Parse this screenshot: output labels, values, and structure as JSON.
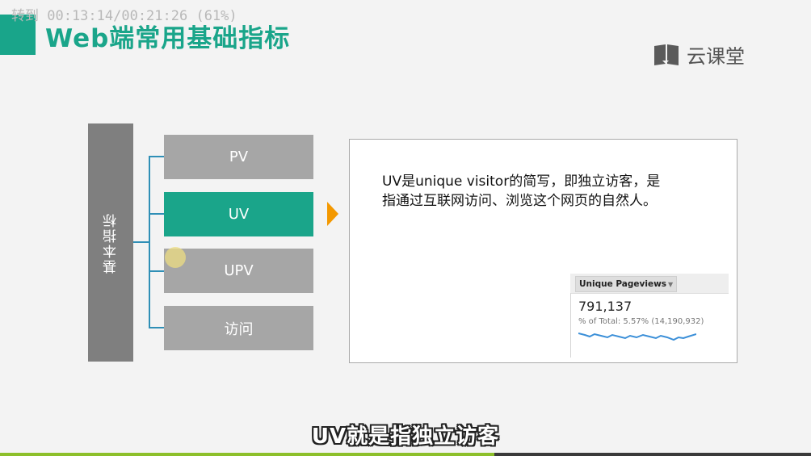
{
  "overlay": {
    "time_text": "转到 00:13:14/00:21:26 (61%)",
    "progress_fraction": 0.61
  },
  "slide": {
    "title": "Web端常用基础指标",
    "logo_text": "云课堂",
    "logo_icon": "book-icon",
    "root_label": "基本指标",
    "metrics": [
      {
        "label": "PV",
        "active": false
      },
      {
        "label": "UV",
        "active": true
      },
      {
        "label": "UPV",
        "active": false
      },
      {
        "label": "访问",
        "active": false
      }
    ],
    "description_line1": "UV是unique visitor的简写，即独立访客，是",
    "description_line2": "指通过互联网访问、浏览这个网页的自然人。",
    "ga_widget": {
      "tab_label": "Unique Pageviews",
      "value": "791,137",
      "subtext": "% of Total: 5.57% (14,190,932)"
    }
  },
  "subtitle": "UV就是指独立访客",
  "colors": {
    "accent": "#1aa58a",
    "inactive": "#a6a6a6",
    "root": "#7f7f7f",
    "arrow": "#f39800",
    "connector": "#2f8fb6"
  }
}
